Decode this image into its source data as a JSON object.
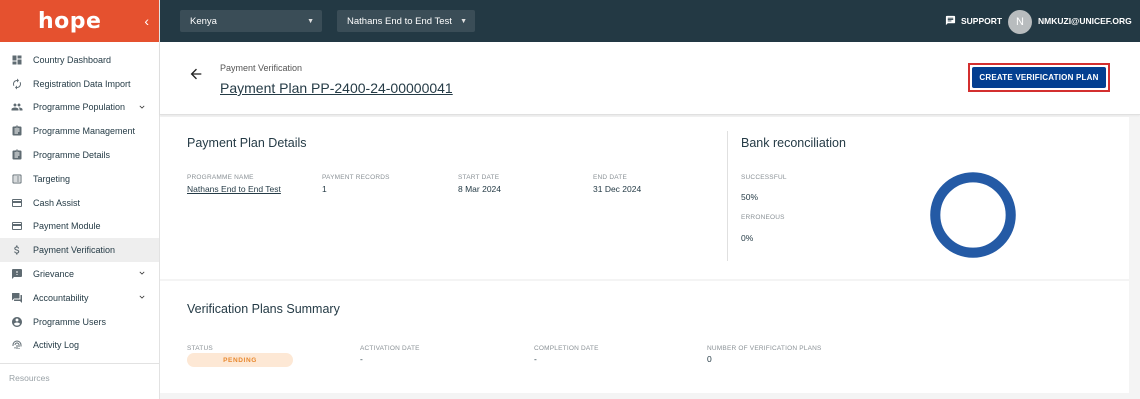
{
  "app": {
    "logo": "hope"
  },
  "sidebar": {
    "items": [
      {
        "label": "Country Dashboard",
        "icon": "dashboard-icon"
      },
      {
        "label": "Registration Data Import",
        "icon": "refresh-icon"
      },
      {
        "label": "Programme Population",
        "icon": "people-icon",
        "expandable": true
      },
      {
        "label": "Programme Management",
        "icon": "clipboard-icon"
      },
      {
        "label": "Programme Details",
        "icon": "clipboard-icon"
      },
      {
        "label": "Targeting",
        "icon": "list-icon"
      },
      {
        "label": "Cash Assist",
        "icon": "card-icon"
      },
      {
        "label": "Payment Module",
        "icon": "card-icon"
      },
      {
        "label": "Payment Verification",
        "icon": "dollar-icon",
        "active": true
      },
      {
        "label": "Grievance",
        "icon": "alert-icon",
        "expandable": true
      },
      {
        "label": "Accountability",
        "icon": "chat-icon",
        "expandable": true
      },
      {
        "label": "Programme Users",
        "icon": "user-circle-icon"
      },
      {
        "label": "Activity Log",
        "icon": "fingerprint-icon"
      }
    ],
    "resources": "Resources"
  },
  "topbar": {
    "country": "Kenya",
    "programme": "Nathans End to End Test",
    "support": "SUPPORT",
    "avatar_initial": "N",
    "user": "NMKUZI@UNICEF.ORG"
  },
  "header": {
    "breadcrumb": "Payment Verification",
    "title": "Payment Plan PP-2400-24-00000041",
    "cta": "CREATE VERIFICATION PLAN"
  },
  "details": {
    "title": "Payment Plan Details",
    "programme_name_label": "PROGRAMME NAME",
    "programme_name": "Nathans End to End Test",
    "payment_records_label": "PAYMENT RECORDS",
    "payment_records": "1",
    "start_date_label": "START DATE",
    "start_date": "8 Mar 2024",
    "end_date_label": "END DATE",
    "end_date": "31 Dec 2024"
  },
  "reconciliation": {
    "title": "Bank reconciliation",
    "successful_label": "SUCCESSFUL",
    "successful": "50%",
    "erroneous_label": "ERRONEOUS",
    "erroneous": "0%",
    "donut_color": "#245aa5"
  },
  "summary": {
    "title": "Verification Plans Summary",
    "status_label": "STATUS",
    "status": "PENDING",
    "activation_label": "ACTIVATION DATE",
    "activation": "-",
    "completion_label": "COMPLETION DATE",
    "completion": "-",
    "count_label": "NUMBER OF VERIFICATION PLANS",
    "count": "0"
  }
}
